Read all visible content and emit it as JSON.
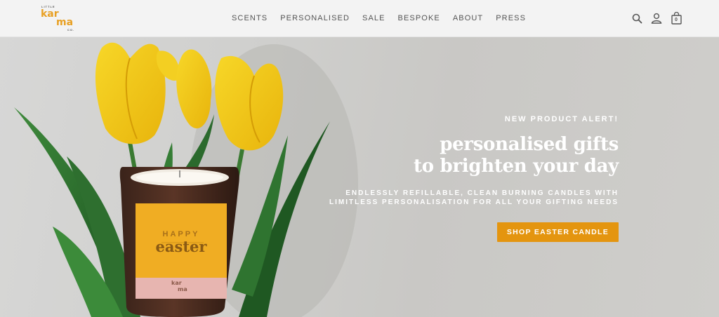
{
  "brand": {
    "logo_small_top": "LITTLE",
    "logo_word_1": "kar",
    "logo_word_2": "ma",
    "logo_small_bottom": "CO.",
    "color": "#e8a023"
  },
  "nav": {
    "items": [
      {
        "label": "SCENTS"
      },
      {
        "label": "PERSONALISED"
      },
      {
        "label": "SALE"
      },
      {
        "label": "BESPOKE"
      },
      {
        "label": "ABOUT"
      },
      {
        "label": "PRESS"
      }
    ]
  },
  "header_icons": {
    "search": "search-icon",
    "account": "user-icon",
    "cart": "shopping-bag-icon",
    "cart_count": "0"
  },
  "hero": {
    "kicker": "NEW PRODUCT ALERT!",
    "headline_line1": "personalised gifts",
    "headline_line2": "to brighten your day",
    "subtext_line1": "ENDLESSLY REFILLABLE, CLEAN BURNING CANDLES WITH",
    "subtext_line2": "LIMITLESS PERSONALISATION FOR ALL YOUR GIFTING NEEDS",
    "cta_label": "SHOP EASTER CANDLE",
    "cta_color": "#e4950f"
  },
  "candle": {
    "label_line1": "HAPPY",
    "label_line2": "easter",
    "brand_line1": "kar",
    "brand_line2": "ma"
  }
}
